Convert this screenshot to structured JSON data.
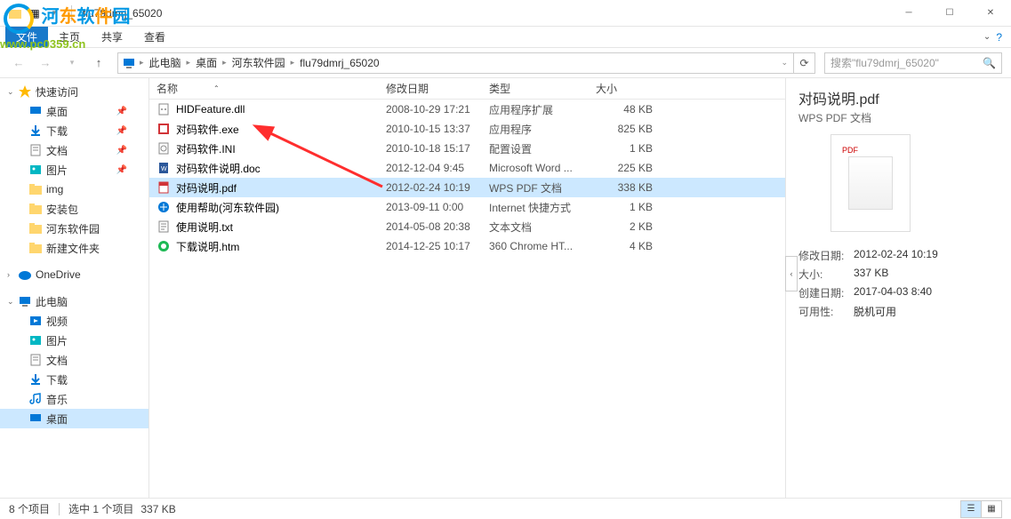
{
  "watermark": {
    "text": "河东软件园",
    "url": "www.pc0359.cn"
  },
  "titlebar": {
    "title": "flu79dmrj_65020"
  },
  "ribbon": {
    "file": "文件",
    "tabs": [
      "主页",
      "共享",
      "查看"
    ]
  },
  "breadcrumb": {
    "items": [
      "此电脑",
      "桌面",
      "河东软件园",
      "flu79dmrj_65020"
    ]
  },
  "search": {
    "placeholder": "搜索\"flu79dmrj_65020\""
  },
  "sidebar": {
    "quick": {
      "label": "快速访问"
    },
    "quick_items": [
      {
        "label": "桌面",
        "pinned": true
      },
      {
        "label": "下载",
        "pinned": true
      },
      {
        "label": "文档",
        "pinned": true
      },
      {
        "label": "图片",
        "pinned": true
      },
      {
        "label": "img",
        "pinned": false
      },
      {
        "label": "安装包",
        "pinned": false
      },
      {
        "label": "河东软件园",
        "pinned": false
      },
      {
        "label": "新建文件夹",
        "pinned": false
      }
    ],
    "onedrive": {
      "label": "OneDrive"
    },
    "thispc": {
      "label": "此电脑"
    },
    "pc_items": [
      {
        "label": "视频"
      },
      {
        "label": "图片"
      },
      {
        "label": "文档"
      },
      {
        "label": "下载"
      },
      {
        "label": "音乐"
      },
      {
        "label": "桌面"
      }
    ]
  },
  "columns": {
    "name": "名称",
    "date": "修改日期",
    "type": "类型",
    "size": "大小"
  },
  "files": [
    {
      "name": "HIDFeature.dll",
      "date": "2008-10-29 17:21",
      "type": "应用程序扩展",
      "size": "48 KB",
      "icon": "dll"
    },
    {
      "name": "对码软件.exe",
      "date": "2010-10-15 13:37",
      "type": "应用程序",
      "size": "825 KB",
      "icon": "exe"
    },
    {
      "name": "对码软件.INI",
      "date": "2010-10-18 15:17",
      "type": "配置设置",
      "size": "1 KB",
      "icon": "ini"
    },
    {
      "name": "对码软件说明.doc",
      "date": "2012-12-04 9:45",
      "type": "Microsoft Word ...",
      "size": "225 KB",
      "icon": "doc"
    },
    {
      "name": "对码说明.pdf",
      "date": "2012-02-24 10:19",
      "type": "WPS PDF 文档",
      "size": "338 KB",
      "icon": "pdf",
      "selected": true
    },
    {
      "name": "使用帮助(河东软件园)",
      "date": "2013-09-11 0:00",
      "type": "Internet 快捷方式",
      "size": "1 KB",
      "icon": "url"
    },
    {
      "name": "使用说明.txt",
      "date": "2014-05-08 20:38",
      "type": "文本文档",
      "size": "2 KB",
      "icon": "txt"
    },
    {
      "name": "下载说明.htm",
      "date": "2014-12-25 10:17",
      "type": "360 Chrome HT...",
      "size": "4 KB",
      "icon": "htm"
    }
  ],
  "preview": {
    "name": "对码说明.pdf",
    "type": "WPS PDF 文档",
    "props": [
      {
        "k": "修改日期:",
        "v": "2012-02-24 10:19"
      },
      {
        "k": "大小:",
        "v": "337 KB"
      },
      {
        "k": "创建日期:",
        "v": "2017-04-03 8:40"
      },
      {
        "k": "可用性:",
        "v": "脱机可用"
      }
    ]
  },
  "statusbar": {
    "count": "8 个项目",
    "selection": "选中 1 个项目",
    "size": "337 KB"
  }
}
